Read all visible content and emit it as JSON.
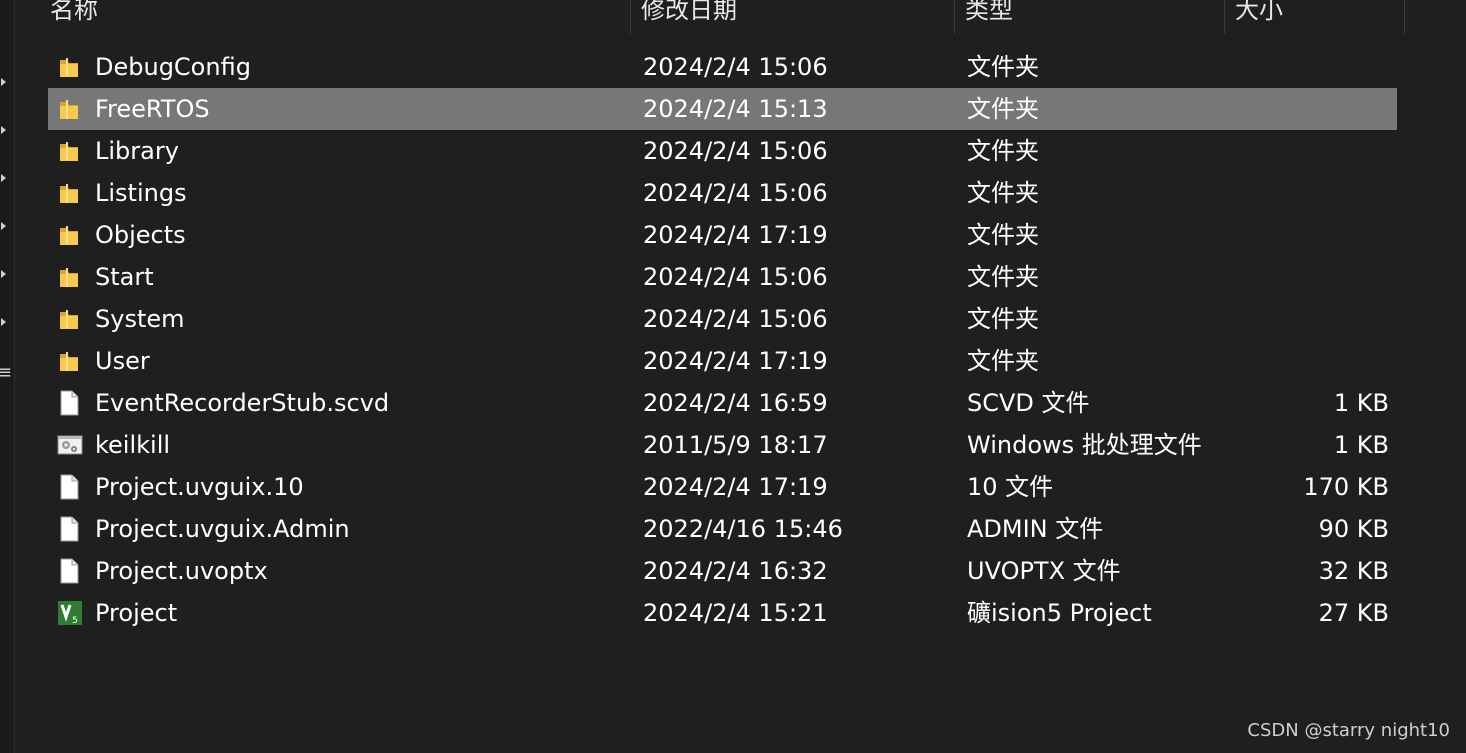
{
  "columns": {
    "name": "名称",
    "date": "修改日期",
    "type": "类型",
    "size": "大小"
  },
  "files": [
    {
      "name": "DebugConfig",
      "date": "2024/2/4 15:06",
      "type": "文件夹",
      "size": "",
      "icon": "folder-icon"
    },
    {
      "name": "FreeRTOS",
      "date": "2024/2/4 15:13",
      "type": "文件夹",
      "size": "",
      "icon": "folder-icon",
      "selected": true
    },
    {
      "name": "Library",
      "date": "2024/2/4 15:06",
      "type": "文件夹",
      "size": "",
      "icon": "folder-icon"
    },
    {
      "name": "Listings",
      "date": "2024/2/4 15:06",
      "type": "文件夹",
      "size": "",
      "icon": "folder-icon"
    },
    {
      "name": "Objects",
      "date": "2024/2/4 17:19",
      "type": "文件夹",
      "size": "",
      "icon": "folder-icon"
    },
    {
      "name": "Start",
      "date": "2024/2/4 15:06",
      "type": "文件夹",
      "size": "",
      "icon": "folder-icon"
    },
    {
      "name": "System",
      "date": "2024/2/4 15:06",
      "type": "文件夹",
      "size": "",
      "icon": "folder-icon"
    },
    {
      "name": "User",
      "date": "2024/2/4 17:19",
      "type": "文件夹",
      "size": "",
      "icon": "folder-icon"
    },
    {
      "name": "EventRecorderStub.scvd",
      "date": "2024/2/4 16:59",
      "type": "SCVD 文件",
      "size": "1 KB",
      "icon": "file-icon"
    },
    {
      "name": "keilkill",
      "date": "2011/5/9 18:17",
      "type": "Windows 批处理文件",
      "size": "1 KB",
      "icon": "batch-file-icon"
    },
    {
      "name": "Project.uvguix.10",
      "date": "2024/2/4 17:19",
      "type": "10 文件",
      "size": "170 KB",
      "icon": "file-icon"
    },
    {
      "name": "Project.uvguix.Admin",
      "date": "2022/4/16 15:46",
      "type": "ADMIN 文件",
      "size": "90 KB",
      "icon": "file-icon"
    },
    {
      "name": "Project.uvoptx",
      "date": "2024/2/4 16:32",
      "type": "UVOPTX 文件",
      "size": "32 KB",
      "icon": "file-icon"
    },
    {
      "name": "Project",
      "date": "2024/2/4 15:21",
      "type": "礦ision5 Project",
      "size": "27 KB",
      "icon": "uvision-project-icon"
    }
  ],
  "watermark": "CSDN @starry night10",
  "colors": {
    "background": "#1f1f1f",
    "selection": "#777777",
    "folder": "#f7c94e"
  }
}
